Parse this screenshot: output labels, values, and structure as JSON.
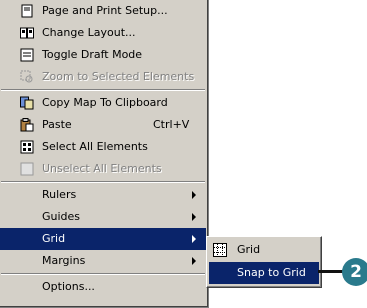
{
  "menu": {
    "items": [
      {
        "label": "Page and Print Setup...",
        "icon": "page-setup-icon"
      },
      {
        "label": "Change Layout...",
        "icon": "change-layout-icon"
      },
      {
        "label": "Toggle Draft Mode",
        "icon": "draft-mode-icon"
      },
      {
        "label": "Zoom to Selected Elements",
        "icon": "zoom-selected-icon",
        "disabled": true
      },
      {
        "label": "Copy Map To Clipboard",
        "icon": "copy-map-icon"
      },
      {
        "label": "Paste",
        "shortcut": "Ctrl+V",
        "icon": "paste-icon"
      },
      {
        "label": "Select All Elements",
        "icon": "select-all-icon"
      },
      {
        "label": "Unselect All Elements",
        "icon": "unselect-all-icon",
        "disabled": true
      },
      {
        "label": "Rulers"
      },
      {
        "label": "Guides"
      },
      {
        "label": "Grid",
        "highlighted": true
      },
      {
        "label": "Margins"
      },
      {
        "label": "Options..."
      }
    ]
  },
  "submenu": {
    "items": [
      {
        "label": "Grid",
        "icon": "grid-icon"
      },
      {
        "label": "Snap to Grid",
        "highlighted": true
      }
    ]
  },
  "callout": {
    "number": "2"
  },
  "colors": {
    "menu_bg": "#d4d0c8",
    "highlight": "#0a246a",
    "callout": "#2a7a8c"
  }
}
